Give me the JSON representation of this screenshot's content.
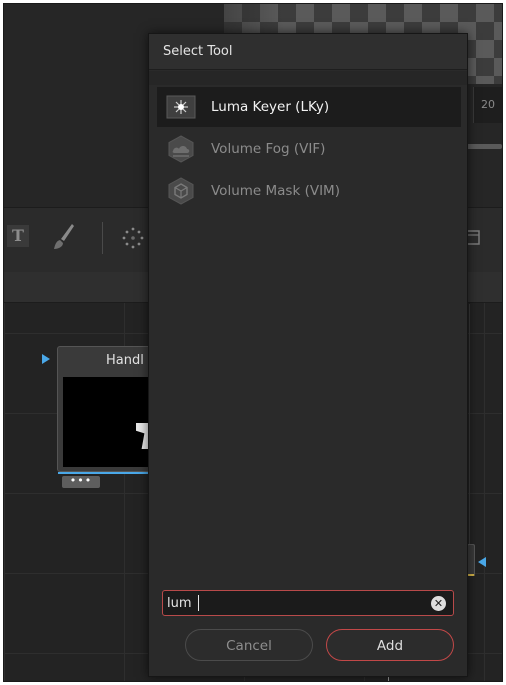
{
  "dialog": {
    "title": "Select Tool",
    "items": [
      {
        "label": "Luma Keyer (LKy)",
        "icon": "luma-keyer-icon",
        "selected": true,
        "enabled": true
      },
      {
        "label": "Volume Fog (VIF)",
        "icon": "volume-fog-icon",
        "selected": false,
        "enabled": false
      },
      {
        "label": "Volume Mask (VIM)",
        "icon": "volume-mask-icon",
        "selected": false,
        "enabled": false
      }
    ],
    "search": {
      "value": "lum",
      "placeholder": ""
    },
    "cancel_label": "Cancel",
    "add_label": "Add"
  },
  "background": {
    "frame_counter": "20",
    "toolbar_text_tool": "T",
    "node": {
      "title": "Handl",
      "dots": "•••"
    }
  },
  "colors": {
    "dialog_bg": "#2a2a2a",
    "selected_row": "#1c1c1c",
    "accent_red": "#c24848",
    "node_link_blue": "#4aa8e8",
    "node_output_yellow": "#d6b64a"
  }
}
